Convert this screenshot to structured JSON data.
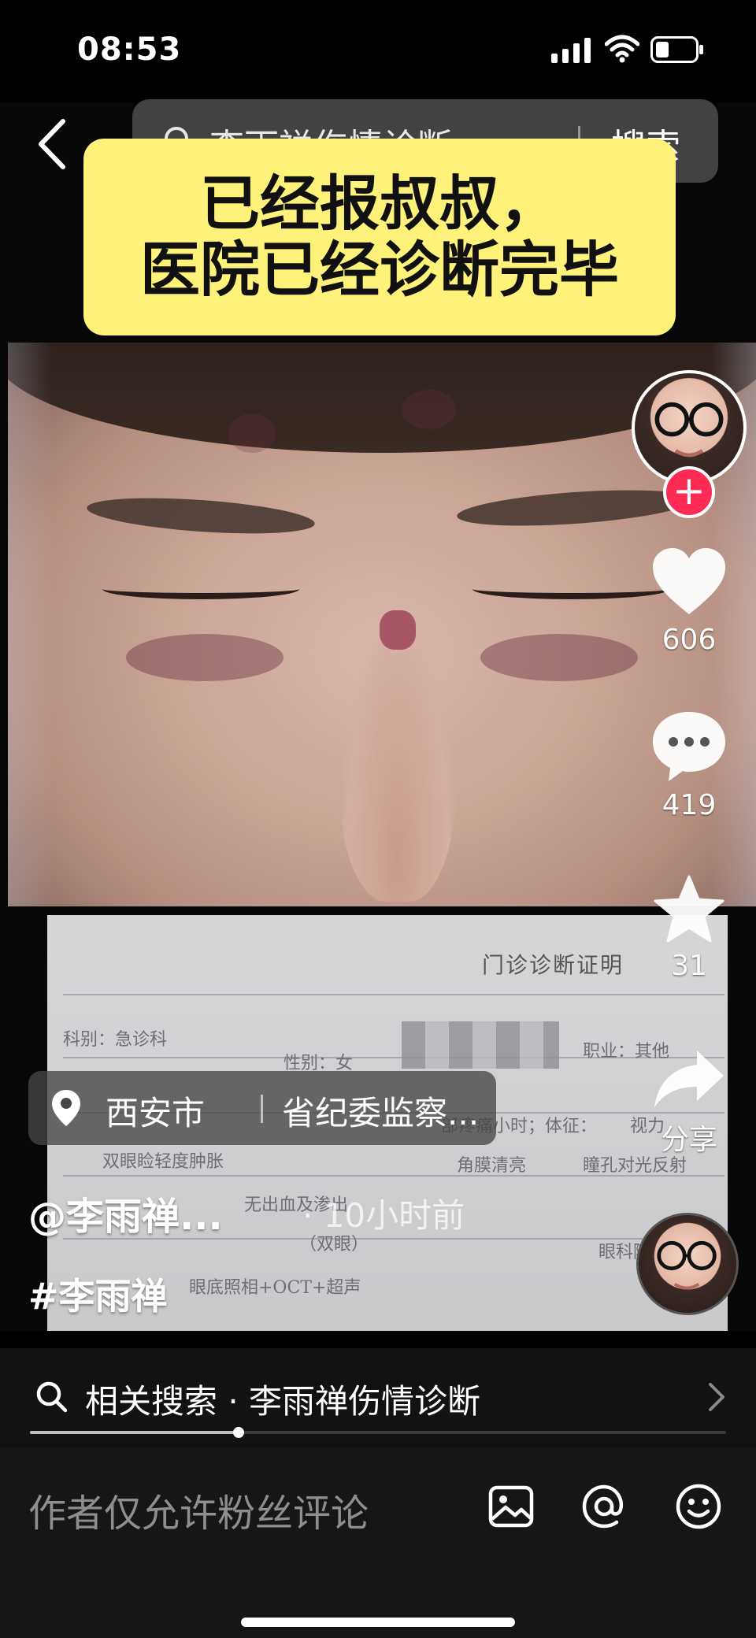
{
  "status_bar": {
    "time": "08:53",
    "icons": [
      "cellular-signal-icon",
      "wifi-icon",
      "battery-icon"
    ]
  },
  "search": {
    "query": "李雨禅伤情诊断",
    "button_label": "搜索"
  },
  "caption": {
    "line1": "已经报叔叔，",
    "line2": "医院已经诊断完毕"
  },
  "document": {
    "title": "门诊诊断证明",
    "fragments": [
      "科别：急诊科",
      "性别：女",
      "职业：其他",
      "部疼痛小时；体征：",
      "视力",
      "双眼睑轻度肿胀",
      "角膜清亮",
      "瞳孔对光反射",
      "无出血及渗出",
      "（双眼）",
      "眼科随诊",
      "眼底照相+OCT+超声"
    ]
  },
  "actions": {
    "likes": "606",
    "comments": "419",
    "favorites": "31",
    "share_label": "分享"
  },
  "location": {
    "city": "西安市",
    "place": "省纪委监察..."
  },
  "author": "@李雨禅...",
  "time_ago": "· 10小时前",
  "hashtag": "#李雨禅",
  "related": {
    "label": "相关搜索 · 李雨禅伤情诊断"
  },
  "progress": 0.3,
  "comment": {
    "placeholder": "作者仅允许粉丝评论"
  },
  "colors": {
    "accent_red": "#fe2c55",
    "caption_yellow": "#fff27a",
    "background": "#000000"
  }
}
